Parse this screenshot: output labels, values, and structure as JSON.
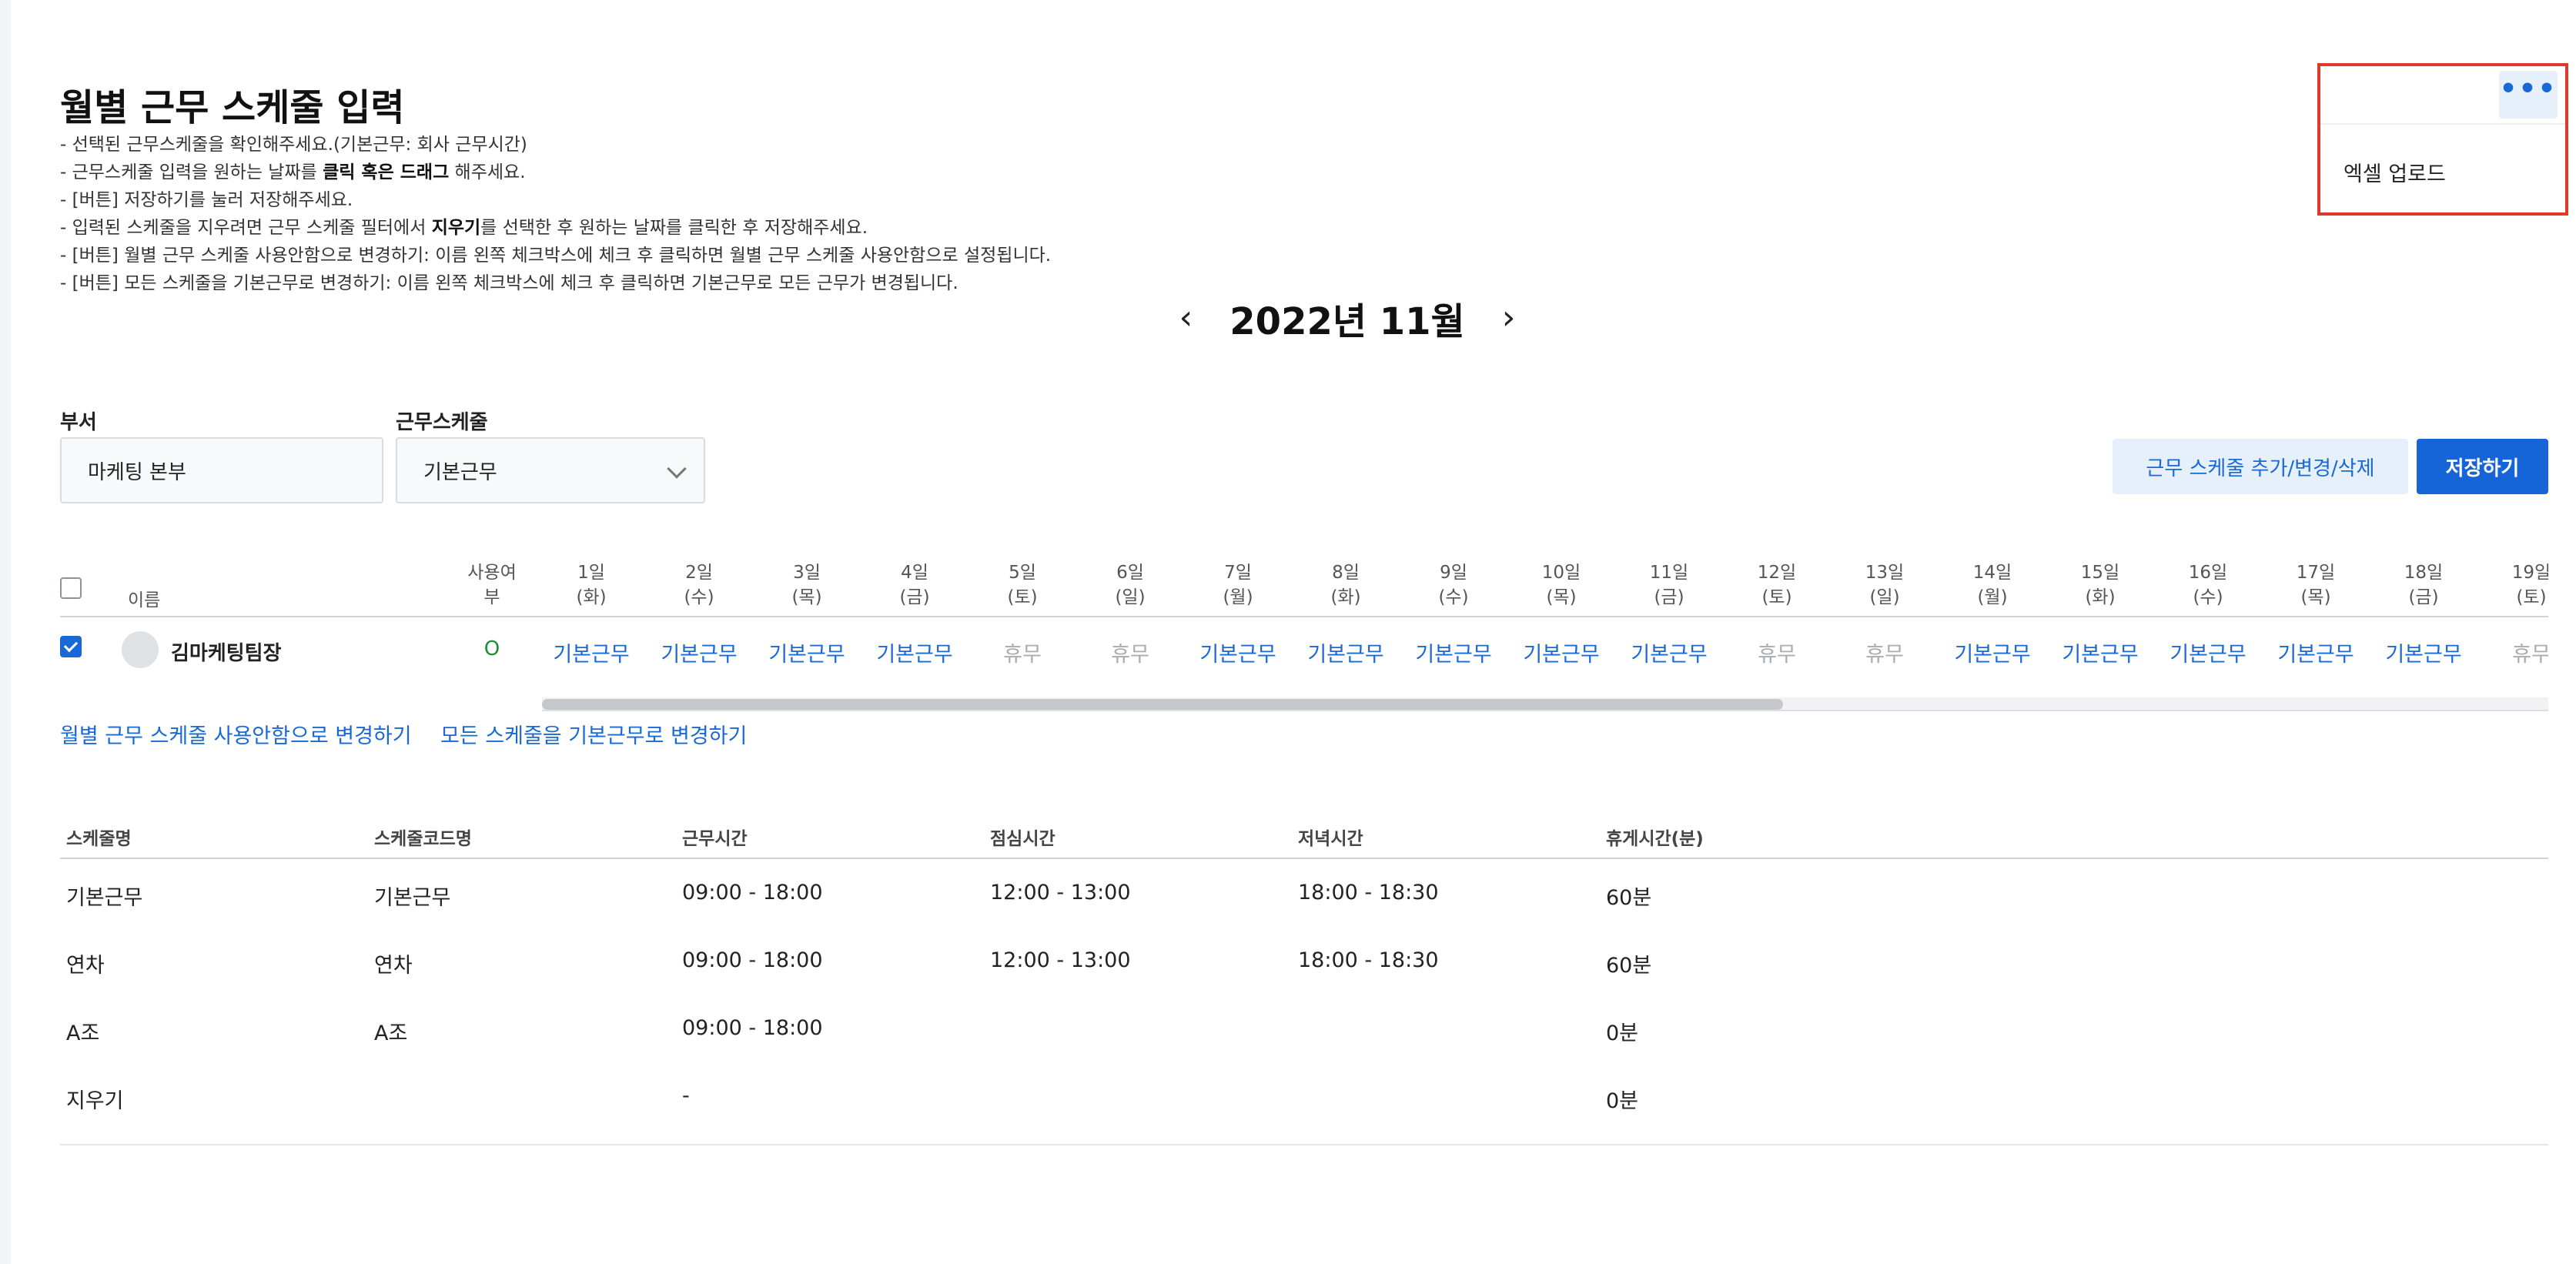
{
  "page": {
    "title": "월별 근무 스케줄 입력",
    "instructions": [
      {
        "pre": "- 선택된 근무스케줄을 확인해주세요.(기본근무: 회사 근무시간)",
        "bold": "",
        "post": ""
      },
      {
        "pre": "- 근무스케줄 입력을 원하는 날짜를 ",
        "bold": "클릭 혹은 드래그",
        "post": " 해주세요."
      },
      {
        "pre": "- [버튼] 저장하기를 눌러 저장해주세요.",
        "bold": "",
        "post": ""
      },
      {
        "pre": "- 입력된 스케줄을 지우려면 근무 스케줄 필터에서 ",
        "bold": "지우기",
        "post": "를 선택한 후 원하는 날짜를 클릭한 후 저장해주세요."
      },
      {
        "pre": "- [버튼] 월별 근무 스케줄 사용안함으로 변경하기: 이름 왼쪽 체크박스에 체크 후 클릭하면 월별 근무 스케줄 사용안함으로 설정됩니다.",
        "bold": "",
        "post": ""
      },
      {
        "pre": "- [버튼] 모든 스케줄을 기본근무로 변경하기: 이름 왼쪽 체크박스에 체크 후 클릭하면 기본근무로 모든 근무가 변경됩니다.",
        "bold": "",
        "post": ""
      }
    ]
  },
  "month_nav": {
    "prev": "‹",
    "label": "2022년 11월",
    "next": "›"
  },
  "filters": {
    "department_label": "부서",
    "department_value": "마케팅 본부",
    "schedule_label": "근무스케줄",
    "schedule_value": "기본근무"
  },
  "actions": {
    "manage_label": "근무 스케줄 추가/변경/삭제",
    "save_label": "저장하기"
  },
  "schedule_table": {
    "name_header": "이름",
    "use_header": "사용여부",
    "days": [
      {
        "d": "1일",
        "w": "(화)"
      },
      {
        "d": "2일",
        "w": "(수)"
      },
      {
        "d": "3일",
        "w": "(목)"
      },
      {
        "d": "4일",
        "w": "(금)"
      },
      {
        "d": "5일",
        "w": "(토)"
      },
      {
        "d": "6일",
        "w": "(일)"
      },
      {
        "d": "7일",
        "w": "(월)"
      },
      {
        "d": "8일",
        "w": "(화)"
      },
      {
        "d": "9일",
        "w": "(수)"
      },
      {
        "d": "10일",
        "w": "(목)"
      },
      {
        "d": "11일",
        "w": "(금)"
      },
      {
        "d": "12일",
        "w": "(토)"
      },
      {
        "d": "13일",
        "w": "(일)"
      },
      {
        "d": "14일",
        "w": "(월)"
      },
      {
        "d": "15일",
        "w": "(화)"
      },
      {
        "d": "16일",
        "w": "(수)"
      },
      {
        "d": "17일",
        "w": "(목)"
      },
      {
        "d": "18일",
        "w": "(금)"
      },
      {
        "d": "19일",
        "w": "(토)"
      }
    ],
    "employee": {
      "name": "김마케팅팀장",
      "use": "O",
      "checked": true,
      "cells": [
        "기본근무",
        "기본근무",
        "기본근무",
        "기본근무",
        "휴무",
        "휴무",
        "기본근무",
        "기본근무",
        "기본근무",
        "기본근무",
        "기본근무",
        "휴무",
        "휴무",
        "기본근무",
        "기본근무",
        "기본근무",
        "기본근무",
        "기본근무",
        "휴무"
      ]
    }
  },
  "links": {
    "disable_monthly": "월별 근무 스케줄 사용안함으로 변경하기",
    "reset_all": "모든 스케줄을 기본근무로 변경하기"
  },
  "code_table": {
    "headers": [
      "스케줄명",
      "스케줄코드명",
      "근무시간",
      "점심시간",
      "저녁시간",
      "휴게시간(분)"
    ],
    "rows": [
      [
        "기본근무",
        "기본근무",
        "09:00 - 18:00",
        "12:00 - 13:00",
        "18:00 - 18:30",
        "60분"
      ],
      [
        "연차",
        "연차",
        "09:00 - 18:00",
        "12:00 - 13:00",
        "18:00 - 18:30",
        "60분"
      ],
      [
        "A조",
        "A조",
        "09:00 - 18:00",
        "",
        "",
        "0분"
      ],
      [
        "지우기",
        "",
        "-",
        "",
        "",
        "0분"
      ]
    ]
  },
  "more_menu": {
    "button_label": "•••",
    "item_excel_upload": "엑셀 업로드"
  },
  "colors": {
    "accent": "#1869d6",
    "primary_button": "#1565d8",
    "light_button": "#e6f0fb",
    "use_ok": "#1c8c3a",
    "off_text": "#a8acb2",
    "highlight_border": "#e0392b"
  }
}
